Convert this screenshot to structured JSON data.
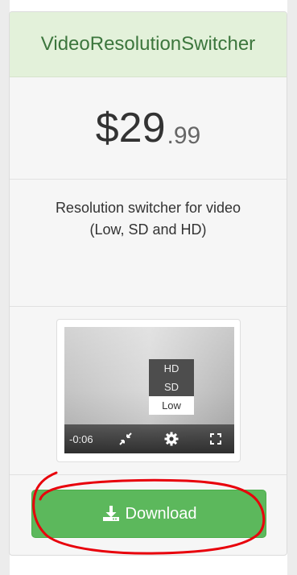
{
  "card": {
    "title": "VideoResolutionSwitcher",
    "price_main": "$29",
    "price_cents": ".99",
    "description_line1": "Resolution switcher for video",
    "description_line2": "(Low, SD and HD)"
  },
  "preview": {
    "resolutions": [
      "HD",
      "SD",
      "Low"
    ],
    "selected_resolution": "Low",
    "time": "-0:06",
    "icons": [
      "exit-fullscreen-icon",
      "gear-icon",
      "fullscreen-icon"
    ]
  },
  "download": {
    "label": "Download",
    "icon": "download-icon"
  },
  "colors": {
    "title_bg": "#e3f1da",
    "title_text": "#3c763d",
    "button_bg": "#5cb85c",
    "annotation": "#e8000b"
  }
}
